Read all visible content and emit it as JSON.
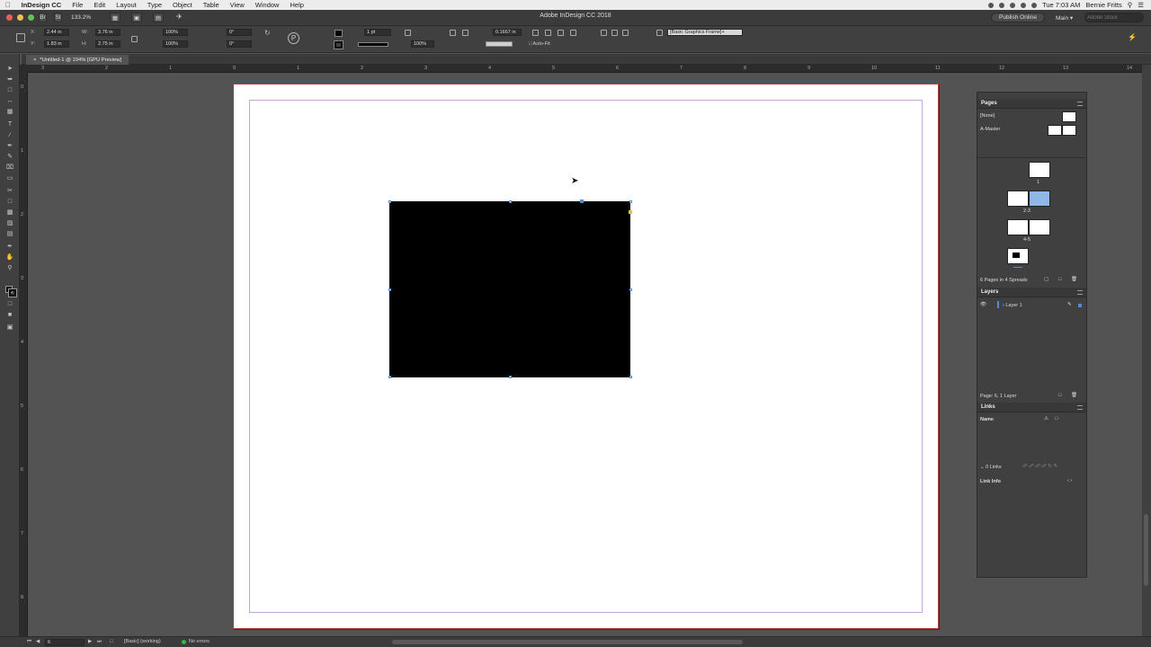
{
  "menubar": {
    "app": "InDesign CC",
    "items": [
      "File",
      "Edit",
      "Layout",
      "Type",
      "Object",
      "Table",
      "View",
      "Window",
      "Help"
    ],
    "clock": "Tue 7:03 AM",
    "user": "Bernie Fritts"
  },
  "titlebar": {
    "zoom": "133.2%",
    "title": "Adobe InDesign CC 2018",
    "publish": "Publish Online",
    "workspace": "Main",
    "search_placeholder": "Adobe Stock"
  },
  "control": {
    "x_label": "X:",
    "x": "2.44 in",
    "y_label": "Y:",
    "y": "1.83 in",
    "w_label": "W:",
    "w": "3.76 in",
    "h_label": "H:",
    "h": "2.75 in",
    "scale_x": "100%",
    "scale_y": "100%",
    "rotate": "0°",
    "shear": "0°",
    "stroke_weight": "1 pt",
    "opacity": "100%",
    "corner": "0.1667 in",
    "auto_fit": "Auto-Fit",
    "object_style": "[Basic Graphics Frame]+"
  },
  "doc_tab": "*Untitled-1 @ 104% [GPU Preview]",
  "ruler": {
    "h_ticks": [
      "3",
      "2",
      "1",
      "0",
      "1",
      "2",
      "3",
      "4",
      "5",
      "6",
      "7",
      "8",
      "9",
      "10",
      "11",
      "12",
      "13",
      "14"
    ],
    "v_ticks": [
      "0",
      "1",
      "2",
      "3",
      "4",
      "5",
      "6",
      "7",
      "8"
    ]
  },
  "pages_panel": {
    "title": "Pages",
    "none": "[None]",
    "master": "A-Master",
    "page_labels": [
      "1",
      "2-3",
      "4-5",
      "6"
    ],
    "summary": "6 Pages in 4 Spreads"
  },
  "layers_panel": {
    "title": "Layers",
    "layer": "Layer 1",
    "summary": "Page: 6, 1 Layer"
  },
  "links_panel": {
    "title": "Links",
    "name_header": "Name",
    "count": "0 Links",
    "link_info": "Link Info"
  },
  "status": {
    "page": "6",
    "profile": "[Basic] (working)",
    "preflight": "No errors"
  },
  "colors": {
    "accent": "#4d8fd6",
    "selected_thumb": "#8fb8e8",
    "ok": "#3cb34a"
  }
}
